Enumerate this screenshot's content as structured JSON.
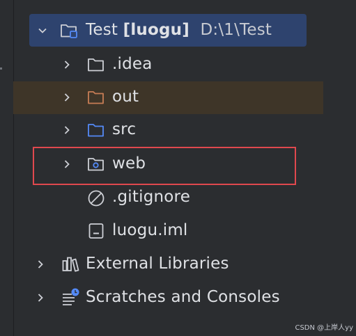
{
  "tree": {
    "project": {
      "name": "Test",
      "module": "[luogu]",
      "path": "D:\\1\\Test"
    },
    "items": [
      {
        "label": ".idea"
      },
      {
        "label": "out"
      },
      {
        "label": "src"
      },
      {
        "label": "web"
      },
      {
        "label": ".gitignore"
      },
      {
        "label": "luogu.iml"
      },
      {
        "label": "External Libraries"
      },
      {
        "label": "Scratches and Consoles"
      }
    ]
  },
  "watermark": "CSDN @上岸人yy",
  "colors": {
    "selection": "#2e436e",
    "excluded_row": "#3e3528",
    "highlight_border": "#e0484e",
    "folder_gray": "#ced0d6",
    "folder_orange": "#c77d55",
    "folder_blue": "#548af7"
  },
  "icons": {
    "project": "module-folder-icon",
    "idea": "folder-icon",
    "out": "excluded-folder-icon",
    "src": "source-folder-icon",
    "web": "web-folder-icon",
    "gitignore": "ignored-file-icon",
    "iml": "module-file-icon",
    "libraries": "library-icon",
    "scratches": "scratches-icon"
  }
}
